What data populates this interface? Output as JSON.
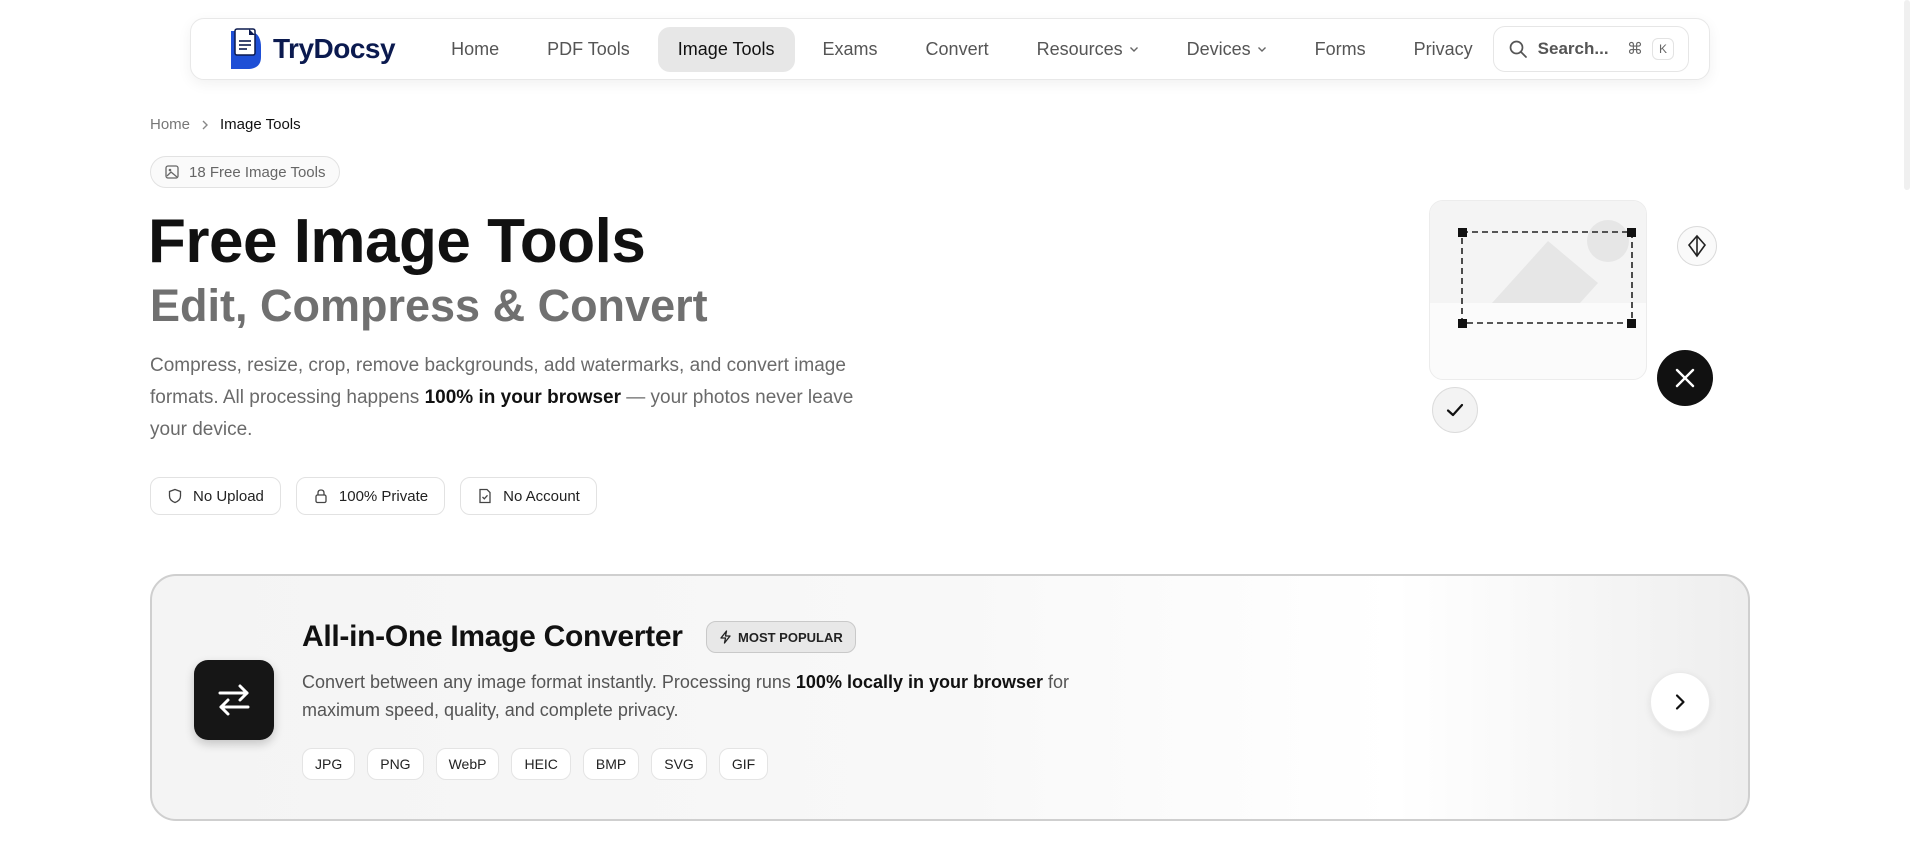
{
  "header": {
    "brand_name": "TryDocsy",
    "nav": [
      {
        "label": "Home",
        "active": false,
        "has_dropdown": false
      },
      {
        "label": "PDF Tools",
        "active": false,
        "has_dropdown": false
      },
      {
        "label": "Image Tools",
        "active": true,
        "has_dropdown": false
      },
      {
        "label": "Exams",
        "active": false,
        "has_dropdown": false
      },
      {
        "label": "Convert",
        "active": false,
        "has_dropdown": false
      },
      {
        "label": "Resources",
        "active": false,
        "has_dropdown": true
      },
      {
        "label": "Devices",
        "active": false,
        "has_dropdown": true
      },
      {
        "label": "Forms",
        "active": false,
        "has_dropdown": false
      },
      {
        "label": "Privacy",
        "active": false,
        "has_dropdown": false
      }
    ],
    "search": {
      "placeholder": "Search...",
      "shortcut_mod": "⌘",
      "shortcut_key": "K"
    }
  },
  "breadcrumb": {
    "home": "Home",
    "separator_icon": "chevron-right-icon",
    "current": "Image Tools"
  },
  "hero": {
    "badge": "18 Free Image Tools",
    "title": "Free Image Tools",
    "subtitle": "Edit, Compress & Convert",
    "desc_part1": "Compress, resize, crop, remove backgrounds, add watermarks, and convert image formats. All processing happens ",
    "desc_bold": "100% in your browser",
    "desc_part2": " — your photos never leave your device.",
    "features": [
      {
        "icon": "shield-icon",
        "label": "No Upload"
      },
      {
        "icon": "lock-icon",
        "label": "100% Private"
      },
      {
        "icon": "file-check-icon",
        "label": "No Account"
      }
    ]
  },
  "converter": {
    "title": "All-in-One Image Converter",
    "badge": "MOST POPULAR",
    "desc_part1": "Convert between any image format instantly. Processing runs ",
    "desc_bold": "100% locally in your browser",
    "desc_part2": " for maximum speed, quality, and complete privacy.",
    "formats": [
      "JPG",
      "PNG",
      "WebP",
      "HEIC",
      "BMP",
      "SVG",
      "GIF"
    ]
  },
  "colors": {
    "accent_blue": "#1e4fd6",
    "brand_navy": "#0b1a4f",
    "dark": "#111111",
    "muted": "#6a6a6a"
  }
}
